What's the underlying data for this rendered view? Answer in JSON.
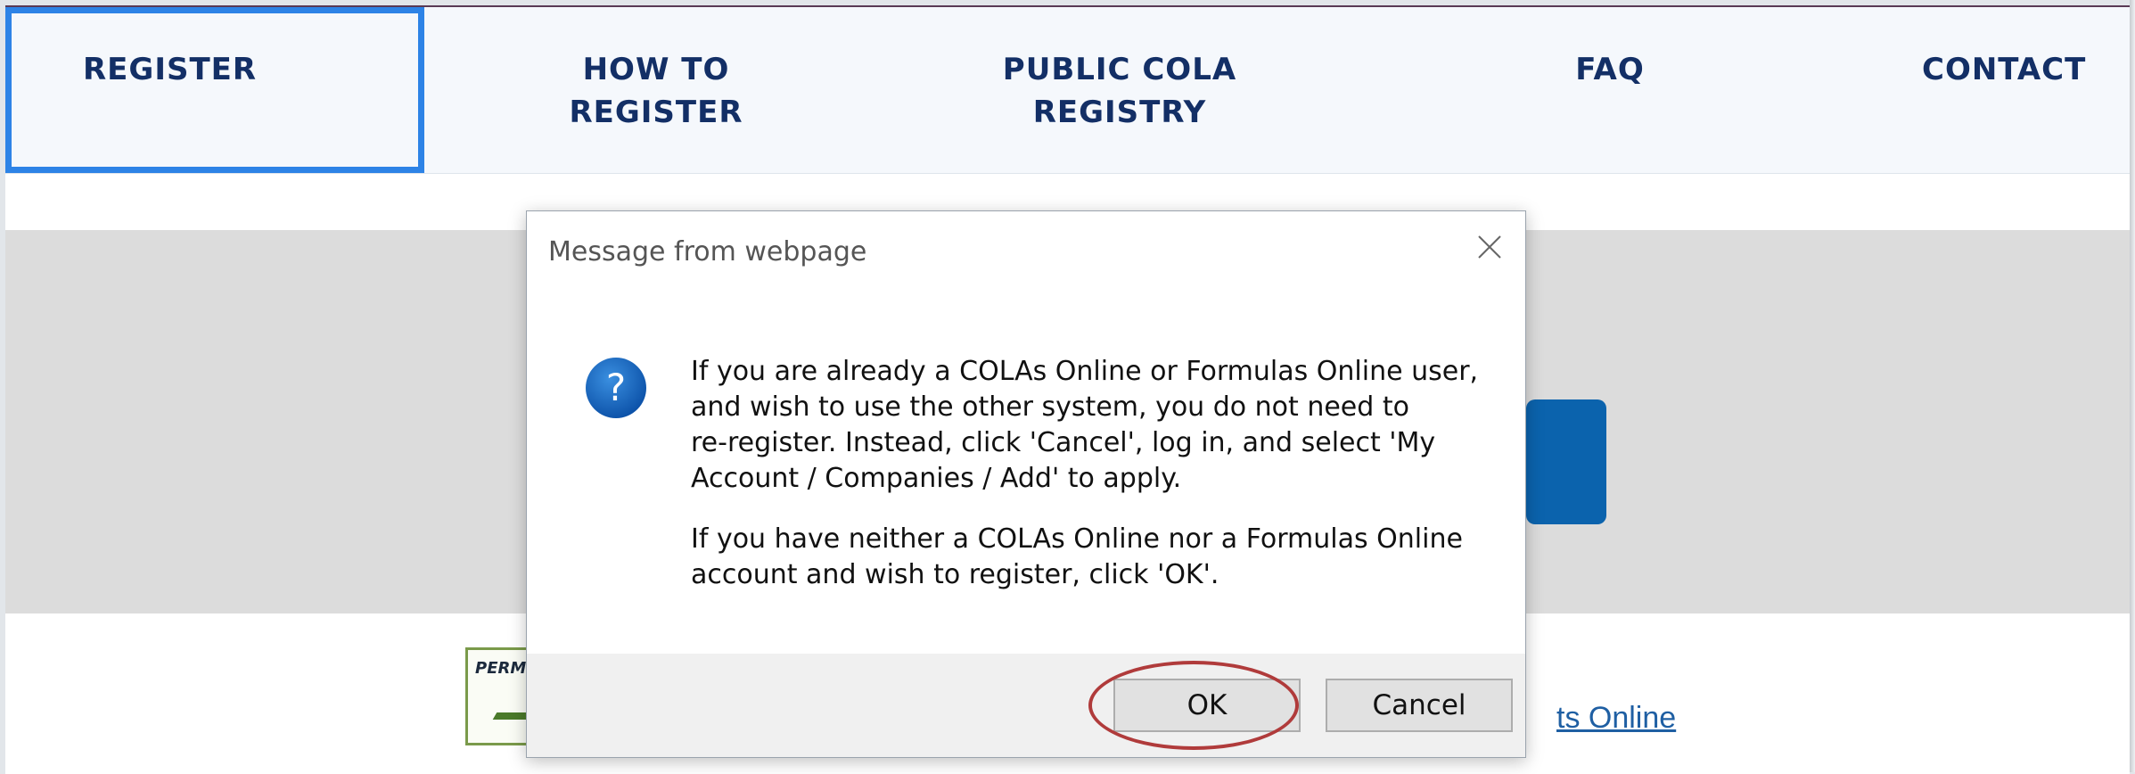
{
  "nav": {
    "items": [
      {
        "label": "REGISTER"
      },
      {
        "label": "HOW TO\nREGISTER"
      },
      {
        "label": "PUBLIC COLA\nREGISTRY"
      },
      {
        "label": "FAQ"
      },
      {
        "label": "CONTACT"
      }
    ]
  },
  "background": {
    "seal_text": "PERM",
    "link_text": "ts Online"
  },
  "dialog": {
    "title": "Message from webpage",
    "message_paragraph_1": "If you are already a COLAs Online or Formulas Online user,\nand wish to use the other system, you do not need to\nre-register. Instead, click 'Cancel', log in, and select 'My\nAccount / Companies / Add' to apply.",
    "message_paragraph_2": "If you have neither a COLAs Online nor a Formulas Online\naccount and wish to register, click 'OK'.",
    "ok_label": "OK",
    "cancel_label": "Cancel",
    "icon": "question-icon",
    "close_icon": "close-icon"
  },
  "colors": {
    "nav_text": "#132f66",
    "active_border": "#2d83e6",
    "highlight_circle": "#b03b3b",
    "hero_button": "#0b63ad"
  }
}
